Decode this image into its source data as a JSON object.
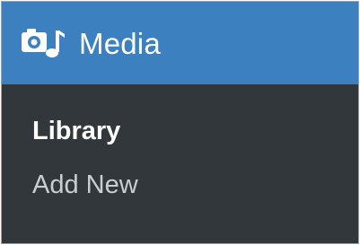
{
  "menu": {
    "icon": "media-camera-music-icon",
    "title": "Media",
    "colors": {
      "header_bg": "#3d80bf",
      "panel_bg": "#32373c",
      "text_active": "#ffffff",
      "text_muted": "#c9ced3"
    }
  },
  "submenu": {
    "items": [
      {
        "label": "Library",
        "active": true
      },
      {
        "label": "Add New",
        "active": false
      }
    ]
  }
}
